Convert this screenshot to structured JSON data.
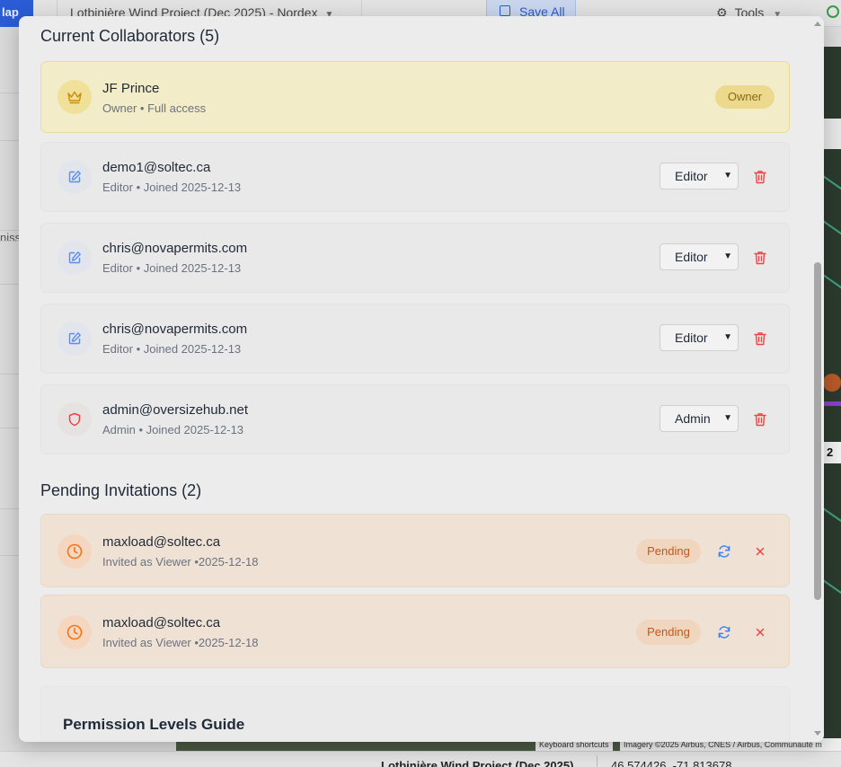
{
  "background": {
    "map_button_label": "lap",
    "project_title": "Lotbinière Wind Project (Dec 2025) - Nordex",
    "save_all_label": "Save All",
    "tools_label": "Tools",
    "left_fragment": "niss",
    "map_badge": "2",
    "map_keyboard": "Keyboard shortcuts",
    "map_imagery": "Imagery ©2025 Airbus, CNES / Airbus, Communauté m",
    "status_project": "Lotbinière Wind Project (Dec 2025)",
    "status_coords": "46.574426, -71.813678"
  },
  "collaborators": {
    "title": "Current Collaborators (5)",
    "owner": {
      "name": "JF Prince",
      "sub": "Owner • Full access",
      "badge": "Owner",
      "icon": "crown-icon"
    },
    "members": [
      {
        "email": "demo1@soltec.ca",
        "sub": "Editor • Joined 2025-12-13",
        "role": "Editor",
        "icon": "edit-icon"
      },
      {
        "email": "chris@novapermits.com",
        "sub": "Editor • Joined 2025-12-13",
        "role": "Editor",
        "icon": "edit-icon"
      },
      {
        "email": "chris@novapermits.com",
        "sub": "Editor • Joined 2025-12-13",
        "role": "Editor",
        "icon": "edit-icon"
      },
      {
        "email": "admin@oversizehub.net",
        "sub": "Admin • Joined 2025-12-13",
        "role": "Admin",
        "icon": "shield-icon"
      }
    ]
  },
  "pending": {
    "title": "Pending Invitations (2)",
    "invites": [
      {
        "email": "maxload@soltec.ca",
        "sub": "Invited as Viewer •2025-12-18",
        "badge": "Pending"
      },
      {
        "email": "maxload@soltec.ca",
        "sub": "Invited as Viewer •2025-12-18",
        "badge": "Pending"
      }
    ]
  },
  "guide": {
    "title": "Permission Levels Guide"
  },
  "colors": {
    "owner_bg": "#f3ecc8",
    "pending_bg": "#efe2d5",
    "accent_blue": "#3b82f6",
    "danger_red": "#ef4444",
    "pending_orange": "#f97316"
  }
}
